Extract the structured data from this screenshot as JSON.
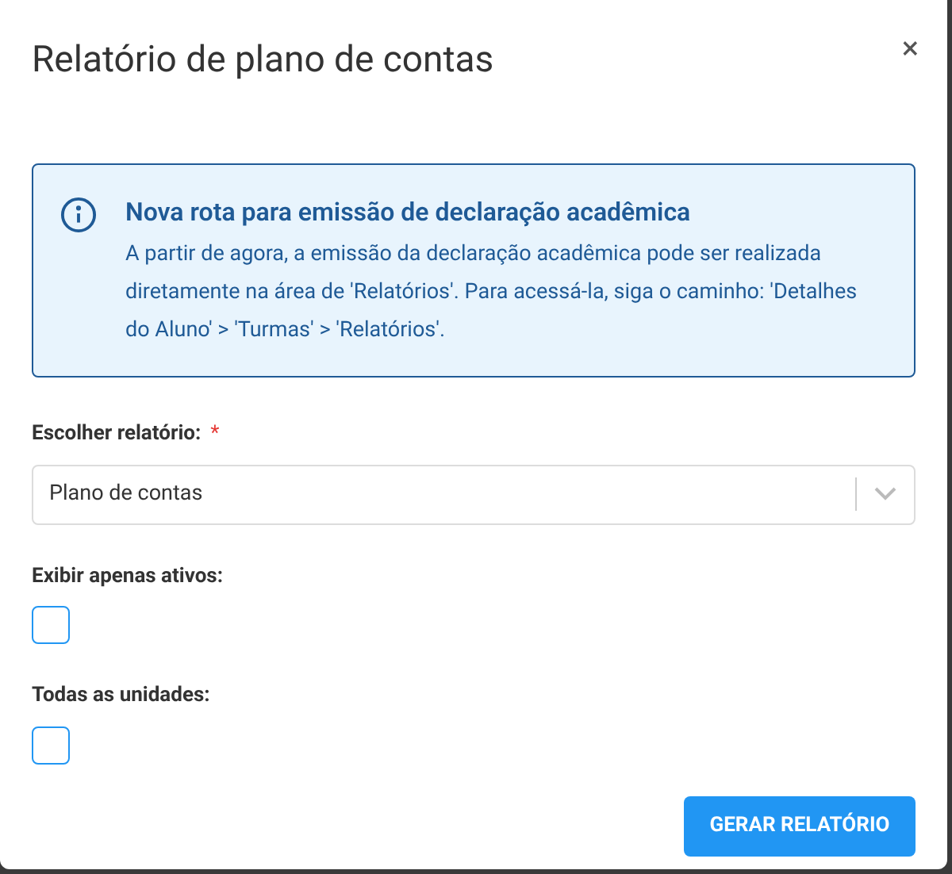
{
  "dialog": {
    "title": "Relatório de plano de contas",
    "close": "×"
  },
  "notice": {
    "title": "Nova rota para emissão de declaração acadêmica",
    "text": "A partir de agora, a emissão da declaração acadêmica pode ser realizada diretamente na área de 'Relatórios'. Para acessá-la, siga o caminho: 'Detalhes do Aluno' > 'Turmas' > 'Relatórios'."
  },
  "report_select": {
    "label": "Escolher relatório:",
    "required": true,
    "required_mark": "*",
    "value": "Plano de contas"
  },
  "checkboxes": [
    {
      "label": "Exibir apenas ativos:",
      "checked": false
    },
    {
      "label": "Todas as unidades:",
      "checked": false
    }
  ],
  "submit": "GERAR RELATÓRIO"
}
